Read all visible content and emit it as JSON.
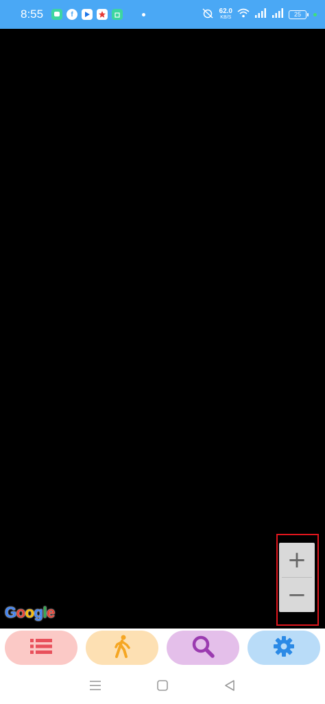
{
  "status_bar": {
    "time": "8:55",
    "net_speed": "62.0",
    "net_unit": "KB/S",
    "battery_level": "25",
    "app_icons": [
      "chat-icon",
      "facebook-icon",
      "play-icon",
      "star-app-icon",
      "store-icon"
    ],
    "colors": {
      "background": "#4aa8f5"
    }
  },
  "map": {
    "attribution": "Google",
    "zoom_in_label": "+",
    "zoom_out_label": "−"
  },
  "toolbar": {
    "buttons": [
      {
        "icon": "list-icon",
        "color": "#e8505b",
        "background": "#fbc9c6"
      },
      {
        "icon": "walking-person-icon",
        "color": "#f5a623",
        "background": "#fde0b3"
      },
      {
        "icon": "search-icon",
        "color": "#9b3bb0",
        "background": "#e4bfea"
      },
      {
        "icon": "gear-icon",
        "color": "#2b8ae6",
        "background": "#b9dcf8"
      }
    ]
  },
  "nav_bar": {
    "buttons": [
      "menu-icon",
      "home-icon",
      "back-icon"
    ]
  }
}
